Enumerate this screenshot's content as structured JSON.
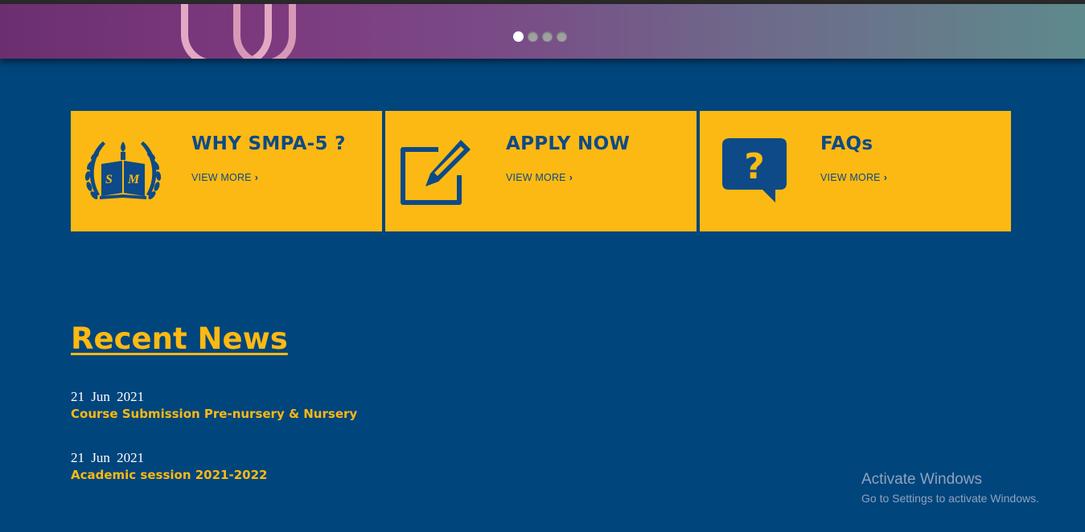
{
  "slider": {
    "dot_count": 4,
    "active_index": 0
  },
  "cards": [
    {
      "title": "WHY SMPA-5 ?",
      "link": "VIEW MORE",
      "icon": "school-emblem-icon",
      "emblem_text": "SM"
    },
    {
      "title": "APPLY NOW",
      "link": "VIEW MORE",
      "icon": "edit-pencil-icon"
    },
    {
      "title": "FAQs",
      "link": "VIEW MORE",
      "icon": "question-bubble-icon"
    }
  ],
  "news": {
    "heading": "Recent News",
    "items": [
      {
        "date": "21 Jun 2021",
        "title": "Course Submission Pre-nursery & Nursery"
      },
      {
        "date": "21 Jun 2021",
        "title": "Academic session 2021-2022"
      }
    ]
  },
  "watermark": {
    "line1": "Activate Windows",
    "line2": "Go to Settings to activate Windows."
  },
  "colors": {
    "background": "#00457c",
    "card": "#fdb913",
    "card_text": "#0d4a87",
    "accent": "#fdb913"
  }
}
